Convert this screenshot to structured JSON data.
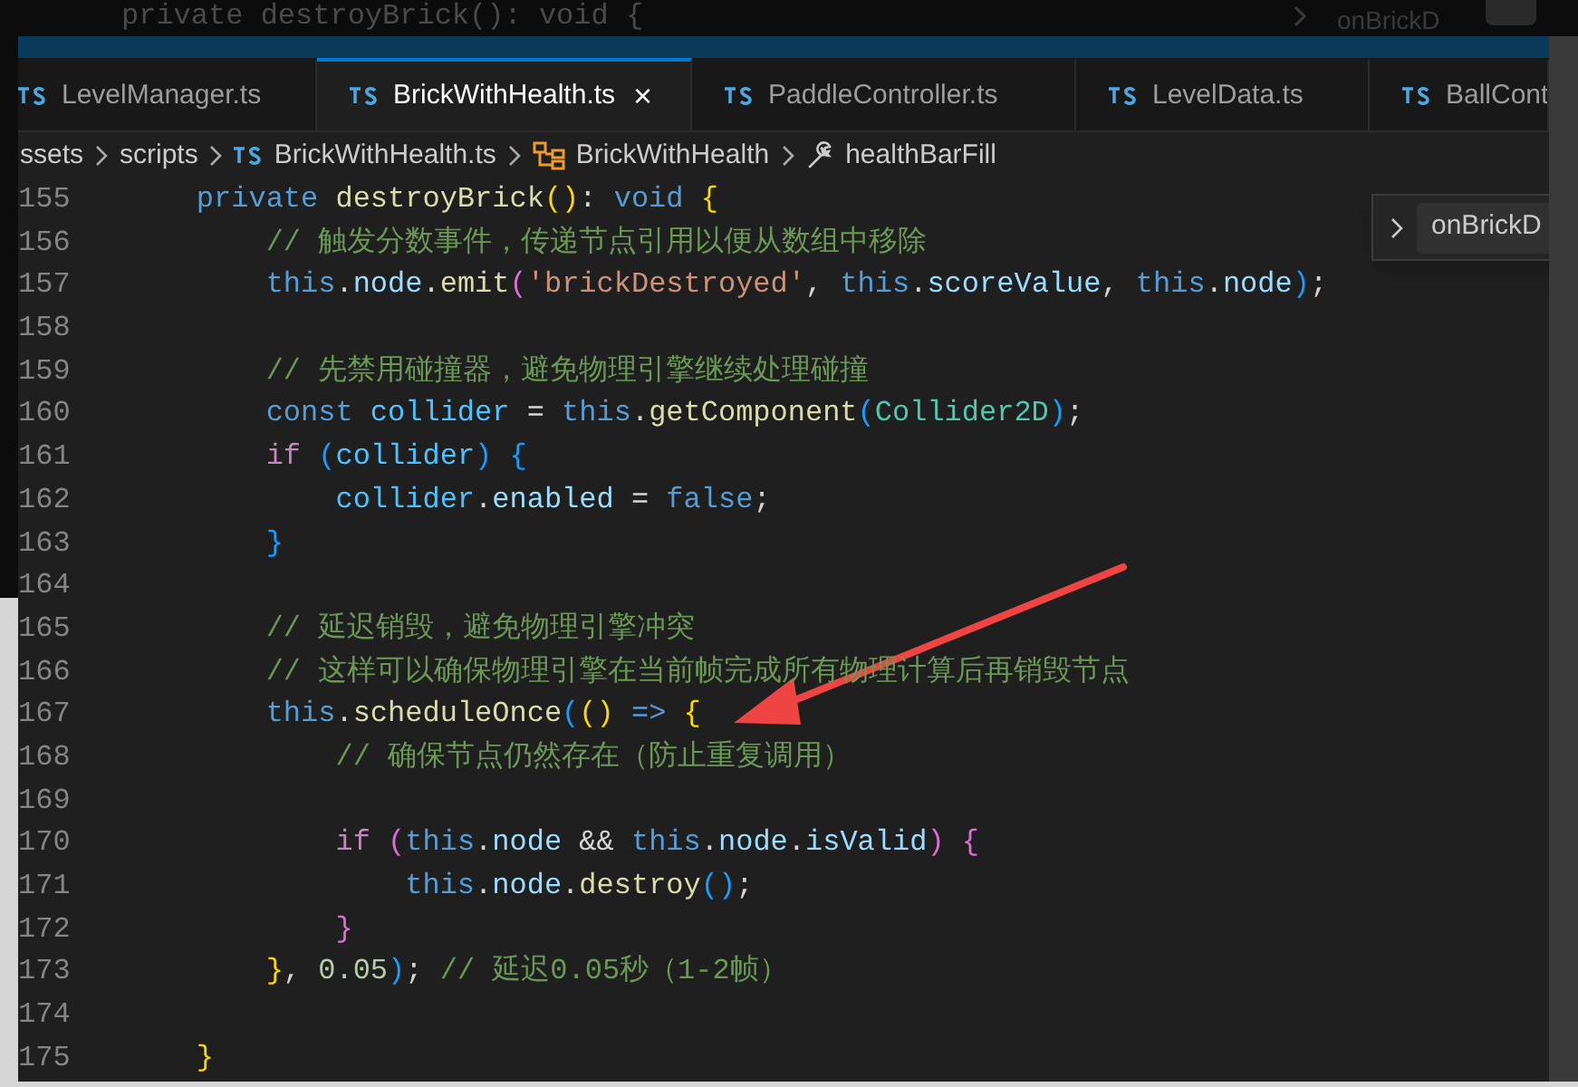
{
  "background_window": {
    "code_line": "private destroyBrick(): void {",
    "find_text": "onBrickD"
  },
  "tabs": [
    {
      "label": "LevelManager.ts",
      "selected": false
    },
    {
      "label": "BrickWithHealth.ts",
      "selected": true,
      "close": "×"
    },
    {
      "label": "PaddleController.ts",
      "selected": false
    },
    {
      "label": "LevelData.ts",
      "selected": false
    },
    {
      "label": "BallCont",
      "selected": false
    }
  ],
  "breadcrumbs": [
    {
      "kind": "folder",
      "label": "ssets"
    },
    {
      "kind": "folder",
      "label": "scripts"
    },
    {
      "kind": "file",
      "label": "BrickWithHealth.ts"
    },
    {
      "kind": "class",
      "label": "BrickWithHealth"
    },
    {
      "kind": "property",
      "label": "healthBarFill"
    }
  ],
  "find_widget": {
    "value": "onBrickD"
  },
  "code_lines": [
    {
      "number": "155",
      "tokens": [
        {
          "kind": "keyword",
          "text": "    private "
        },
        {
          "kind": "function",
          "text": "destroyBrick"
        },
        {
          "kind": "bracket1",
          "text": "()"
        },
        {
          "kind": "plain",
          "text": ": "
        },
        {
          "kind": "keyword",
          "text": "void "
        },
        {
          "kind": "bracket1",
          "text": "{"
        }
      ]
    },
    {
      "number": "156",
      "tokens": [
        {
          "kind": "comment",
          "text": "        // 触发分数事件，传递节点引用以便从数组中移除"
        }
      ]
    },
    {
      "number": "157",
      "tokens": [
        {
          "kind": "keyword",
          "text": "        this"
        },
        {
          "kind": "plain",
          "text": "."
        },
        {
          "kind": "property",
          "text": "node"
        },
        {
          "kind": "plain",
          "text": "."
        },
        {
          "kind": "function",
          "text": "emit"
        },
        {
          "kind": "bracket2",
          "text": "("
        },
        {
          "kind": "string",
          "text": "'brickDestroyed'"
        },
        {
          "kind": "plain",
          "text": ", "
        },
        {
          "kind": "keyword",
          "text": "this"
        },
        {
          "kind": "plain",
          "text": "."
        },
        {
          "kind": "property",
          "text": "scoreValue"
        },
        {
          "kind": "plain",
          "text": ", "
        },
        {
          "kind": "keyword",
          "text": "this"
        },
        {
          "kind": "plain",
          "text": "."
        },
        {
          "kind": "property",
          "text": "node"
        },
        {
          "kind": "bracket3",
          "text": ")"
        },
        {
          "kind": "plain",
          "text": ";"
        }
      ]
    },
    {
      "number": "158"
    },
    {
      "number": "159",
      "tokens": [
        {
          "kind": "comment",
          "text": "        // 先禁用碰撞器，避免物理引擎继续处理碰撞"
        }
      ]
    },
    {
      "number": "160",
      "tokens": [
        {
          "kind": "keyword",
          "text": "        const "
        },
        {
          "kind": "variable",
          "text": "collider"
        },
        {
          "kind": "plain",
          "text": " = "
        },
        {
          "kind": "keyword",
          "text": "this"
        },
        {
          "kind": "plain",
          "text": "."
        },
        {
          "kind": "function",
          "text": "getComponent"
        },
        {
          "kind": "bracket3",
          "text": "("
        },
        {
          "kind": "type",
          "text": "Collider2D"
        },
        {
          "kind": "bracket3",
          "text": ")"
        },
        {
          "kind": "plain",
          "text": ";"
        }
      ]
    },
    {
      "number": "161",
      "tokens": [
        {
          "kind": "control",
          "text": "        if "
        },
        {
          "kind": "bracket3",
          "text": "("
        },
        {
          "kind": "variable",
          "text": "collider"
        },
        {
          "kind": "bracket3",
          "text": ") {"
        }
      ]
    },
    {
      "number": "162",
      "tokens": [
        {
          "kind": "variable",
          "text": "            collider"
        },
        {
          "kind": "plain",
          "text": "."
        },
        {
          "kind": "property",
          "text": "enabled"
        },
        {
          "kind": "plain",
          "text": " = "
        },
        {
          "kind": "keyword",
          "text": "false"
        },
        {
          "kind": "plain",
          "text": ";"
        }
      ]
    },
    {
      "number": "163",
      "tokens": [
        {
          "kind": "bracket3",
          "text": "        }"
        }
      ]
    },
    {
      "number": "164"
    },
    {
      "number": "165",
      "tokens": [
        {
          "kind": "comment",
          "text": "        // 延迟销毁，避免物理引擎冲突"
        }
      ]
    },
    {
      "number": "166",
      "tokens": [
        {
          "kind": "comment",
          "text": "        // 这样可以确保物理引擎在当前帧完成所有物理计算后再销毁节点"
        }
      ]
    },
    {
      "number": "167",
      "tokens": [
        {
          "kind": "keyword",
          "text": "        this"
        },
        {
          "kind": "plain",
          "text": "."
        },
        {
          "kind": "function",
          "text": "scheduleOnce"
        },
        {
          "kind": "bracket3",
          "text": "("
        },
        {
          "kind": "bracket1",
          "text": "() "
        },
        {
          "kind": "keyword",
          "text": "=> "
        },
        {
          "kind": "bracket1",
          "text": "{"
        }
      ]
    },
    {
      "number": "168",
      "tokens": [
        {
          "kind": "comment",
          "text": "            // 确保节点仍然存在（防止重复调用）"
        }
      ]
    },
    {
      "number": "169"
    },
    {
      "number": "170",
      "tokens": [
        {
          "kind": "control",
          "text": "            if "
        },
        {
          "kind": "bracket2",
          "text": "("
        },
        {
          "kind": "keyword",
          "text": "this"
        },
        {
          "kind": "plain",
          "text": "."
        },
        {
          "kind": "property",
          "text": "node"
        },
        {
          "kind": "plain",
          "text": " && "
        },
        {
          "kind": "keyword",
          "text": "this"
        },
        {
          "kind": "plain",
          "text": "."
        },
        {
          "kind": "property",
          "text": "node"
        },
        {
          "kind": "plain",
          "text": "."
        },
        {
          "kind": "property",
          "text": "isValid"
        },
        {
          "kind": "bracket2",
          "text": ") {"
        }
      ]
    },
    {
      "number": "171",
      "tokens": [
        {
          "kind": "keyword",
          "text": "                this"
        },
        {
          "kind": "plain",
          "text": "."
        },
        {
          "kind": "property",
          "text": "node"
        },
        {
          "kind": "plain",
          "text": "."
        },
        {
          "kind": "function",
          "text": "destroy"
        },
        {
          "kind": "bracket3",
          "text": "()"
        },
        {
          "kind": "plain",
          "text": ";"
        }
      ]
    },
    {
      "number": "172",
      "tokens": [
        {
          "kind": "bracket2",
          "text": "            }"
        }
      ]
    },
    {
      "number": "173",
      "tokens": [
        {
          "kind": "bracket1",
          "text": "        }"
        },
        {
          "kind": "plain",
          "text": ", "
        },
        {
          "kind": "number",
          "text": "0.05"
        },
        {
          "kind": "bracket3",
          "text": ")"
        },
        {
          "kind": "plain",
          "text": "; "
        },
        {
          "kind": "comment",
          "text": "// 延迟0.05秒（1-2帧）"
        }
      ]
    },
    {
      "number": "174"
    },
    {
      "number": "175",
      "tokens": [
        {
          "kind": "bracket1",
          "text": "    }"
        }
      ]
    }
  ]
}
